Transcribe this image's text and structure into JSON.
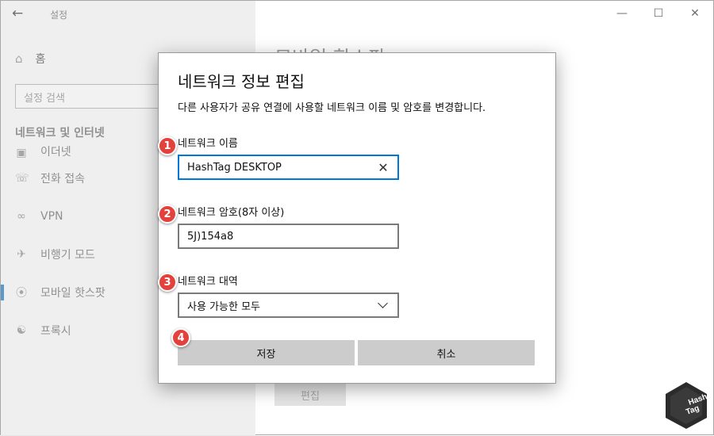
{
  "window": {
    "title": "설정",
    "back_icon": "back-arrow-icon",
    "controls": [
      "minimize-icon",
      "maximize-icon",
      "close-icon"
    ]
  },
  "sidebar": {
    "home_label": "홈",
    "search_placeholder": "설정 검색",
    "section_title": "네트워크 및 인터넷",
    "items": [
      {
        "label": "이더넷",
        "icon": "ethernet-icon"
      },
      {
        "label": "전화 접속",
        "icon": "dialup-icon"
      },
      {
        "label": "VPN",
        "icon": "vpn-icon"
      },
      {
        "label": "비행기 모드",
        "icon": "airplane-icon"
      },
      {
        "label": "모바일 핫스팟",
        "icon": "hotspot-icon",
        "active": true
      },
      {
        "label": "프록시",
        "icon": "globe-icon"
      }
    ]
  },
  "content": {
    "title": "모바일 핫스팟",
    "edit_button": "편집"
  },
  "dialog": {
    "title": "네트워크 정보 편집",
    "description": "다른 사용자가 공유 연결에 사용할 네트워크 이름 및 암호를 변경합니다.",
    "name_label": "네트워크 이름",
    "name_value": "HashTag DESKTOP",
    "password_label": "네트워크 암호(8자 이상)",
    "password_value": "5J)154a8",
    "band_label": "네트워크 대역",
    "band_value": "사용 가능한 모두",
    "save_button": "저장",
    "cancel_button": "취소"
  },
  "badges": [
    "1",
    "2",
    "3",
    "4"
  ],
  "colors": {
    "accent": "#0078d7",
    "badge": "#e3413c",
    "sidebar_bg": "#e6e6e6",
    "button_bg": "#cccccc"
  }
}
